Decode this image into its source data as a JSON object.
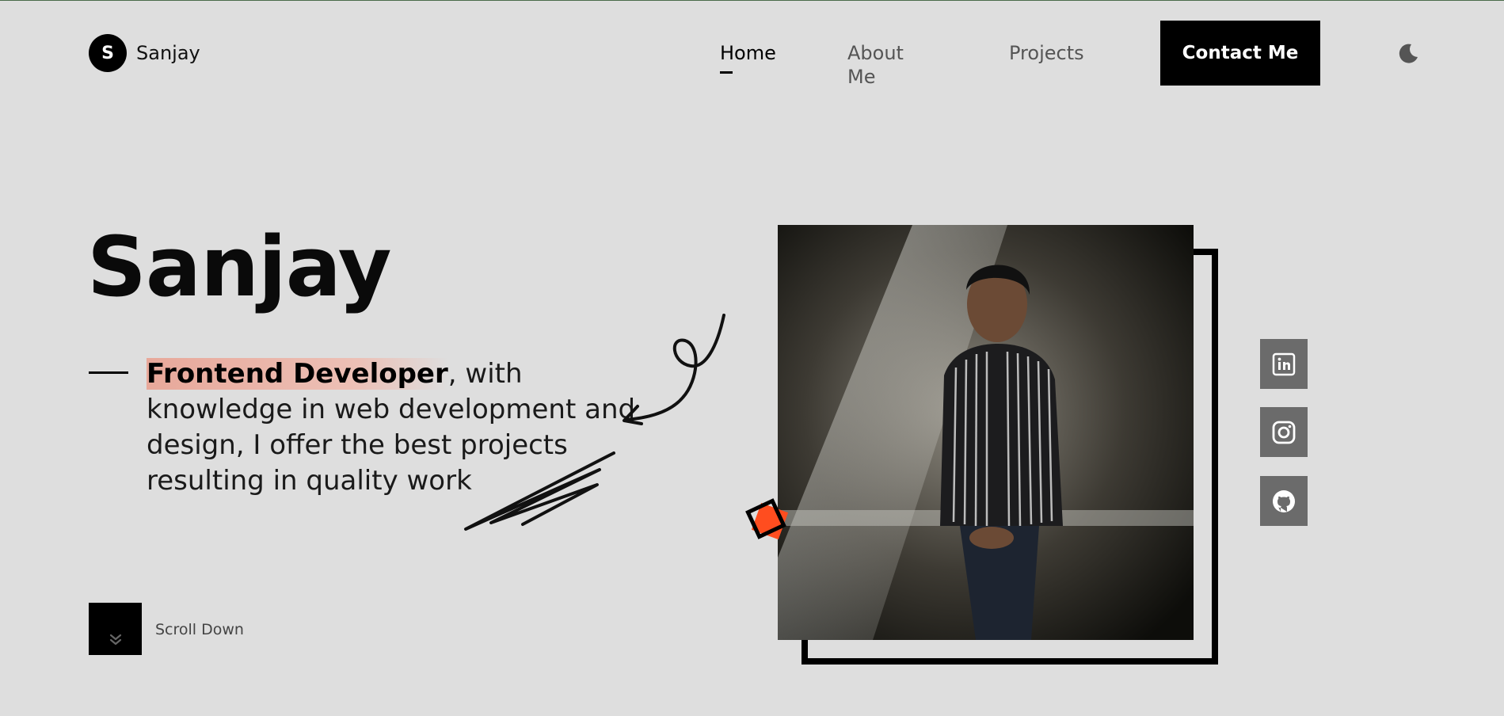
{
  "header": {
    "logo_letter": "S",
    "logo_name": "Sanjay",
    "nav": [
      {
        "label": "Home",
        "active": true
      },
      {
        "label": "About Me",
        "active": false
      },
      {
        "label": "Projects",
        "active": false
      }
    ],
    "contact_label": "Contact Me",
    "theme_icon": "moon-icon"
  },
  "hero": {
    "title": "Sanjay",
    "role": "Frontend Developer",
    "description_rest": ", with knowledge in web development and design, I offer the best projects resulting in quality work"
  },
  "social": [
    {
      "icon": "linkedin-icon"
    },
    {
      "icon": "instagram-icon"
    },
    {
      "icon": "github-icon"
    }
  ],
  "scroll": {
    "label": "Scroll Down",
    "icon": "chevron-double-down-icon"
  },
  "colors": {
    "background": "#dedede",
    "accent": "#ff4d1f",
    "highlight": "#e8a89a",
    "social_bg": "#6b6b6b"
  }
}
